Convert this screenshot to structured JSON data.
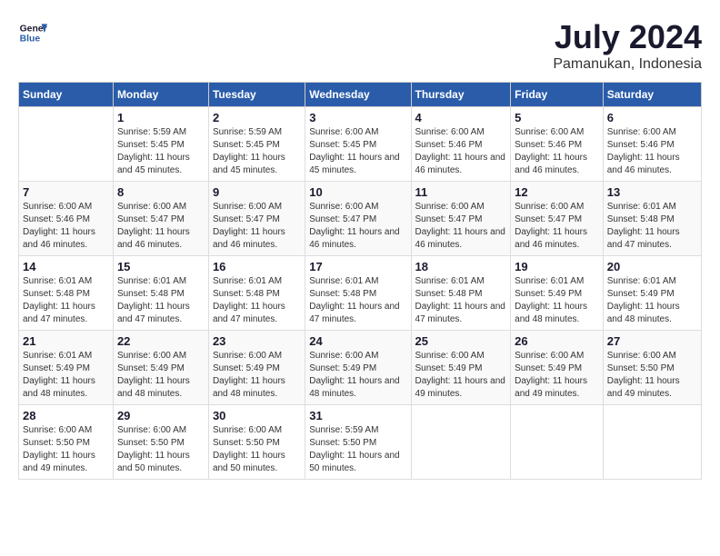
{
  "logo": {
    "line1": "General",
    "line2": "Blue"
  },
  "title": "July 2024",
  "subtitle": "Pamanukan, Indonesia",
  "days_of_week": [
    "Sunday",
    "Monday",
    "Tuesday",
    "Wednesday",
    "Thursday",
    "Friday",
    "Saturday"
  ],
  "weeks": [
    [
      {
        "day": "",
        "sunrise": "",
        "sunset": "",
        "daylight": ""
      },
      {
        "day": "1",
        "sunrise": "Sunrise: 5:59 AM",
        "sunset": "Sunset: 5:45 PM",
        "daylight": "Daylight: 11 hours and 45 minutes."
      },
      {
        "day": "2",
        "sunrise": "Sunrise: 5:59 AM",
        "sunset": "Sunset: 5:45 PM",
        "daylight": "Daylight: 11 hours and 45 minutes."
      },
      {
        "day": "3",
        "sunrise": "Sunrise: 6:00 AM",
        "sunset": "Sunset: 5:45 PM",
        "daylight": "Daylight: 11 hours and 45 minutes."
      },
      {
        "day": "4",
        "sunrise": "Sunrise: 6:00 AM",
        "sunset": "Sunset: 5:46 PM",
        "daylight": "Daylight: 11 hours and 46 minutes."
      },
      {
        "day": "5",
        "sunrise": "Sunrise: 6:00 AM",
        "sunset": "Sunset: 5:46 PM",
        "daylight": "Daylight: 11 hours and 46 minutes."
      },
      {
        "day": "6",
        "sunrise": "Sunrise: 6:00 AM",
        "sunset": "Sunset: 5:46 PM",
        "daylight": "Daylight: 11 hours and 46 minutes."
      }
    ],
    [
      {
        "day": "7",
        "sunrise": "Sunrise: 6:00 AM",
        "sunset": "Sunset: 5:46 PM",
        "daylight": "Daylight: 11 hours and 46 minutes."
      },
      {
        "day": "8",
        "sunrise": "Sunrise: 6:00 AM",
        "sunset": "Sunset: 5:47 PM",
        "daylight": "Daylight: 11 hours and 46 minutes."
      },
      {
        "day": "9",
        "sunrise": "Sunrise: 6:00 AM",
        "sunset": "Sunset: 5:47 PM",
        "daylight": "Daylight: 11 hours and 46 minutes."
      },
      {
        "day": "10",
        "sunrise": "Sunrise: 6:00 AM",
        "sunset": "Sunset: 5:47 PM",
        "daylight": "Daylight: 11 hours and 46 minutes."
      },
      {
        "day": "11",
        "sunrise": "Sunrise: 6:00 AM",
        "sunset": "Sunset: 5:47 PM",
        "daylight": "Daylight: 11 hours and 46 minutes."
      },
      {
        "day": "12",
        "sunrise": "Sunrise: 6:00 AM",
        "sunset": "Sunset: 5:47 PM",
        "daylight": "Daylight: 11 hours and 46 minutes."
      },
      {
        "day": "13",
        "sunrise": "Sunrise: 6:01 AM",
        "sunset": "Sunset: 5:48 PM",
        "daylight": "Daylight: 11 hours and 47 minutes."
      }
    ],
    [
      {
        "day": "14",
        "sunrise": "Sunrise: 6:01 AM",
        "sunset": "Sunset: 5:48 PM",
        "daylight": "Daylight: 11 hours and 47 minutes."
      },
      {
        "day": "15",
        "sunrise": "Sunrise: 6:01 AM",
        "sunset": "Sunset: 5:48 PM",
        "daylight": "Daylight: 11 hours and 47 minutes."
      },
      {
        "day": "16",
        "sunrise": "Sunrise: 6:01 AM",
        "sunset": "Sunset: 5:48 PM",
        "daylight": "Daylight: 11 hours and 47 minutes."
      },
      {
        "day": "17",
        "sunrise": "Sunrise: 6:01 AM",
        "sunset": "Sunset: 5:48 PM",
        "daylight": "Daylight: 11 hours and 47 minutes."
      },
      {
        "day": "18",
        "sunrise": "Sunrise: 6:01 AM",
        "sunset": "Sunset: 5:48 PM",
        "daylight": "Daylight: 11 hours and 47 minutes."
      },
      {
        "day": "19",
        "sunrise": "Sunrise: 6:01 AM",
        "sunset": "Sunset: 5:49 PM",
        "daylight": "Daylight: 11 hours and 48 minutes."
      },
      {
        "day": "20",
        "sunrise": "Sunrise: 6:01 AM",
        "sunset": "Sunset: 5:49 PM",
        "daylight": "Daylight: 11 hours and 48 minutes."
      }
    ],
    [
      {
        "day": "21",
        "sunrise": "Sunrise: 6:01 AM",
        "sunset": "Sunset: 5:49 PM",
        "daylight": "Daylight: 11 hours and 48 minutes."
      },
      {
        "day": "22",
        "sunrise": "Sunrise: 6:00 AM",
        "sunset": "Sunset: 5:49 PM",
        "daylight": "Daylight: 11 hours and 48 minutes."
      },
      {
        "day": "23",
        "sunrise": "Sunrise: 6:00 AM",
        "sunset": "Sunset: 5:49 PM",
        "daylight": "Daylight: 11 hours and 48 minutes."
      },
      {
        "day": "24",
        "sunrise": "Sunrise: 6:00 AM",
        "sunset": "Sunset: 5:49 PM",
        "daylight": "Daylight: 11 hours and 48 minutes."
      },
      {
        "day": "25",
        "sunrise": "Sunrise: 6:00 AM",
        "sunset": "Sunset: 5:49 PM",
        "daylight": "Daylight: 11 hours and 49 minutes."
      },
      {
        "day": "26",
        "sunrise": "Sunrise: 6:00 AM",
        "sunset": "Sunset: 5:49 PM",
        "daylight": "Daylight: 11 hours and 49 minutes."
      },
      {
        "day": "27",
        "sunrise": "Sunrise: 6:00 AM",
        "sunset": "Sunset: 5:50 PM",
        "daylight": "Daylight: 11 hours and 49 minutes."
      }
    ],
    [
      {
        "day": "28",
        "sunrise": "Sunrise: 6:00 AM",
        "sunset": "Sunset: 5:50 PM",
        "daylight": "Daylight: 11 hours and 49 minutes."
      },
      {
        "day": "29",
        "sunrise": "Sunrise: 6:00 AM",
        "sunset": "Sunset: 5:50 PM",
        "daylight": "Daylight: 11 hours and 50 minutes."
      },
      {
        "day": "30",
        "sunrise": "Sunrise: 6:00 AM",
        "sunset": "Sunset: 5:50 PM",
        "daylight": "Daylight: 11 hours and 50 minutes."
      },
      {
        "day": "31",
        "sunrise": "Sunrise: 5:59 AM",
        "sunset": "Sunset: 5:50 PM",
        "daylight": "Daylight: 11 hours and 50 minutes."
      },
      {
        "day": "",
        "sunrise": "",
        "sunset": "",
        "daylight": ""
      },
      {
        "day": "",
        "sunrise": "",
        "sunset": "",
        "daylight": ""
      },
      {
        "day": "",
        "sunrise": "",
        "sunset": "",
        "daylight": ""
      }
    ]
  ]
}
